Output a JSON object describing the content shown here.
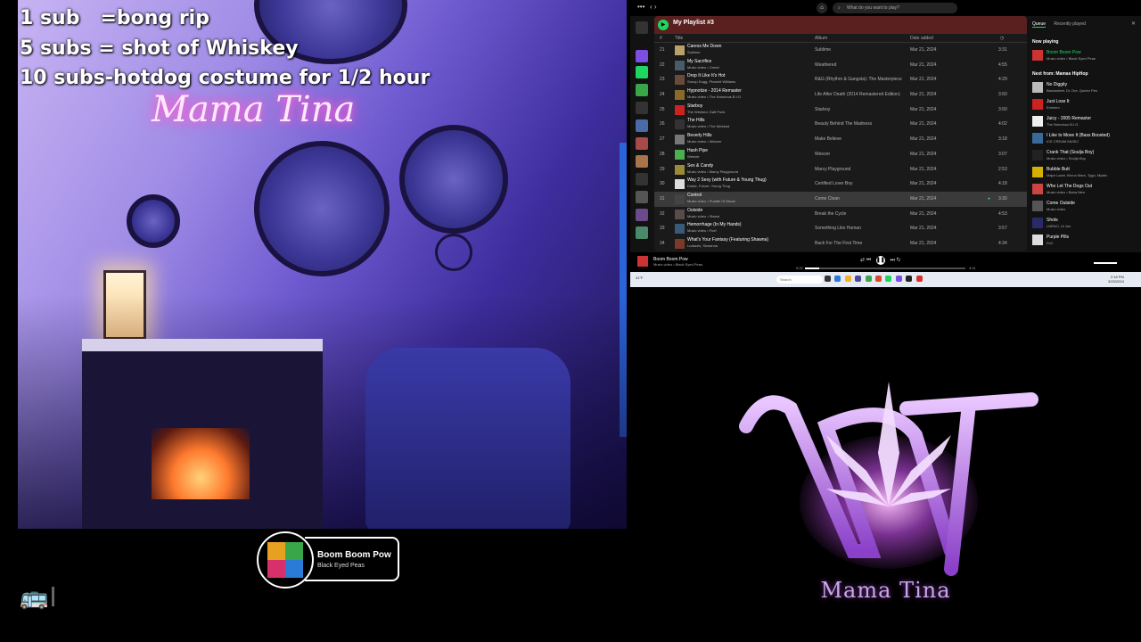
{
  "overlay": {
    "sub_rules": [
      "1 sub   =bong rip",
      "5 subs = shot of Whiskey",
      "10 subs-hotdog costume for 1/2 hour"
    ],
    "neon_sign": "Mama Tina"
  },
  "now_playing_widget": {
    "title": "Boom Boom Pow",
    "artist": "Black Eyed Peas"
  },
  "spotify": {
    "search_placeholder": "What do you want to play?",
    "playlist_title": "My Playlist #3",
    "columns": [
      "#",
      "Title",
      "Album",
      "Date added",
      "◷"
    ],
    "rows": [
      {
        "num": "21",
        "title": "Caress Me Down",
        "artist": "Sublime",
        "album": "Sublime",
        "date": "Mar 21, 2024",
        "dur": "3:31",
        "color": "#b8a26a"
      },
      {
        "num": "22",
        "title": "My Sacrifice",
        "artist": "Music video • Creed",
        "album": "Weathered",
        "date": "Mar 21, 2024",
        "dur": "4:55",
        "color": "#4a5a6a"
      },
      {
        "num": "23",
        "title": "Drop It Like It's Hot",
        "artist": "Snoop Dogg, Pharrell Williams",
        "album": "R&G (Rhythm & Gangsta): The Masterpiece",
        "date": "Mar 21, 2024",
        "dur": "4:29",
        "color": "#6a4a3a"
      },
      {
        "num": "24",
        "title": "Hypnotize - 2014 Remaster",
        "artist": "Music video • The Notorious B.I.G.",
        "album": "Life After Death (2014 Remastered Edition)",
        "date": "Mar 21, 2024",
        "dur": "3:50",
        "color": "#8a6a2a"
      },
      {
        "num": "25",
        "title": "Starboy",
        "artist": "The Weeknd, Daft Punk",
        "album": "Starboy",
        "date": "Mar 21, 2024",
        "dur": "3:50",
        "color": "#c22"
      },
      {
        "num": "26",
        "title": "The Hills",
        "artist": "Music video • The Weeknd",
        "album": "Beauty Behind The Madness",
        "date": "Mar 21, 2024",
        "dur": "4:02",
        "color": "#333"
      },
      {
        "num": "27",
        "title": "Beverly Hills",
        "artist": "Music video • Weezer",
        "album": "Make Believe",
        "date": "Mar 21, 2024",
        "dur": "3:18",
        "color": "#777"
      },
      {
        "num": "28",
        "title": "Hash Pipe",
        "artist": "Weezer",
        "album": "Weezer",
        "date": "Mar 21, 2024",
        "dur": "3:07",
        "color": "#4caf50"
      },
      {
        "num": "29",
        "title": "Sex & Candy",
        "artist": "Music video • Marcy Playground",
        "album": "Marcy Playground",
        "date": "Mar 21, 2024",
        "dur": "2:53",
        "color": "#9a8a3a"
      },
      {
        "num": "30",
        "title": "Way 2 Sexy (with Future & Young Thug)",
        "artist": "Drake, Future, Young Thug",
        "album": "Certified Lover Boy",
        "date": "Mar 21, 2024",
        "dur": "4:18",
        "color": "#ddd"
      },
      {
        "num": "31",
        "title": "Control",
        "artist": "Music video • Puddle Of Mudd",
        "album": "Come Clean",
        "date": "Mar 21, 2024",
        "dur": "3:30",
        "color": "#444",
        "active": true
      },
      {
        "num": "32",
        "title": "Outside",
        "artist": "Music video • Staind",
        "album": "Break the Cycle",
        "date": "Mar 21, 2024",
        "dur": "4:53",
        "color": "#5a4a4a"
      },
      {
        "num": "33",
        "title": "Hemorrhage (In My Hands)",
        "artist": "Music video • Fuel",
        "album": "Something Like Human",
        "date": "Mar 21, 2024",
        "dur": "3:57",
        "color": "#3a5a7a"
      },
      {
        "num": "34",
        "title": "What's Your Fantasy (Featuring Shawna)",
        "artist": "Ludacris, Shawnna",
        "album": "Back For The First Time",
        "date": "Mar 21, 2024",
        "dur": "4:34",
        "color": "#7a3a2a"
      }
    ],
    "queue": {
      "tab_active": "Queue",
      "tab_other": "Recently played",
      "now_playing_label": "Now playing",
      "current": {
        "title": "Boom Boom Pow",
        "sub": "Music video • Black Eyed Peas",
        "color": "#c33"
      },
      "next_label": "Next from: Mamas HipHop",
      "items": [
        {
          "title": "No Diggity",
          "sub": "Blackstreet, Dr. Dre, Queen Pen",
          "color": "#bbb"
        },
        {
          "title": "Just Lose It",
          "sub": "Eminem",
          "color": "#c22"
        },
        {
          "title": "Juicy - 2005 Remaster",
          "sub": "The Notorious B.I.G.",
          "color": "#eee"
        },
        {
          "title": "I Like to Move It (Bass Boosted)",
          "sub": "ICE CREAM MUSIC",
          "color": "#3a6a9a"
        },
        {
          "title": "Crank That (Soulja Boy)",
          "sub": "Music video • Soulja Boy",
          "color": "#222"
        },
        {
          "title": "Bubble Butt",
          "sub": "Major Lazer, Bruno Mars, Tyga, Mystic",
          "color": "#d4b000"
        },
        {
          "title": "Who Let The Dogs Out",
          "sub": "Music video • Baha Men",
          "color": "#c44"
        },
        {
          "title": "Come Outside",
          "sub": "Music video",
          "color": "#555"
        },
        {
          "title": "Shots",
          "sub": "LMFAO, Lil Jon",
          "color": "#2a2a6a"
        },
        {
          "title": "Purple Pills",
          "sub": "D12",
          "color": "#ddd"
        }
      ]
    },
    "player": {
      "title": "Boom Boom Pow",
      "sub": "Music video • Black Eyed Peas",
      "time_elapsed": "0:22",
      "time_total": "4:11",
      "progress": 0.09
    }
  },
  "taskbar": {
    "search_placeholder": "Search",
    "weather": "41°F",
    "time": "2:16 PM",
    "date": "3/23/2024"
  },
  "logo": {
    "monogram": "MT",
    "name": "Mama Tina"
  }
}
